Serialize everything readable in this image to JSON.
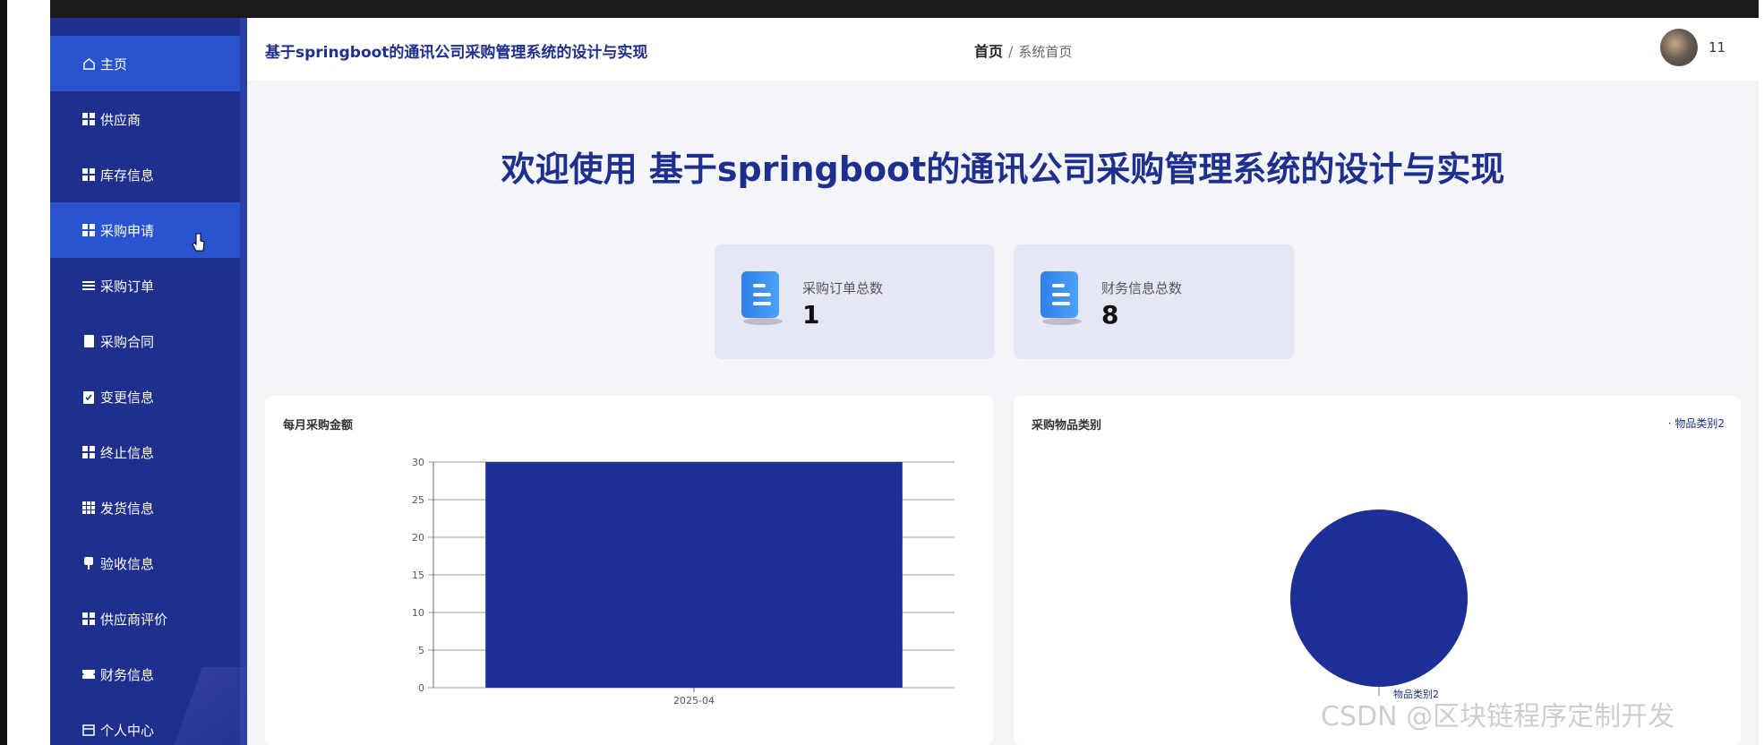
{
  "app": {
    "title": "基于springboot的通讯公司采购管理系统的设计与实现"
  },
  "sidebar": {
    "items": [
      {
        "label": "主页",
        "icon": "home-icon",
        "active": true
      },
      {
        "label": "供应商",
        "icon": "grid-icon",
        "active": false
      },
      {
        "label": "库存信息",
        "icon": "grid-icon",
        "active": false
      },
      {
        "label": "采购申请",
        "icon": "grid-icon",
        "active": true
      },
      {
        "label": "采购订单",
        "icon": "list-icon",
        "active": false
      },
      {
        "label": "采购合同",
        "icon": "clipboard-icon",
        "active": false
      },
      {
        "label": "变更信息",
        "icon": "clipboard-check-icon",
        "active": false
      },
      {
        "label": "终止信息",
        "icon": "grid-icon",
        "active": false
      },
      {
        "label": "发货信息",
        "icon": "table-icon",
        "active": false
      },
      {
        "label": "验收信息",
        "icon": "stamp-icon",
        "active": false
      },
      {
        "label": "供应商评价",
        "icon": "grid-icon",
        "active": false
      },
      {
        "label": "财务信息",
        "icon": "ticket-icon",
        "active": false
      },
      {
        "label": "个人中心",
        "icon": "window-icon",
        "active": false
      }
    ]
  },
  "header": {
    "breadcrumb": {
      "home": "首页",
      "separator": "/",
      "current": "系统首页"
    },
    "user": {
      "name": "11"
    }
  },
  "welcome": {
    "text": "欢迎使用 基于springboot的通讯公司采购管理系统的设计与实现"
  },
  "stats": [
    {
      "label": "采购订单总数",
      "value": "1",
      "icon": "document-icon"
    },
    {
      "label": "财务信息总数",
      "value": "8",
      "icon": "document-icon"
    }
  ],
  "chart_data": [
    {
      "type": "bar",
      "title": "每月采购金额",
      "categories": [
        "2025-04"
      ],
      "values": [
        30
      ],
      "ylim": [
        0,
        30
      ],
      "yticks": [
        0,
        5,
        10,
        15,
        20,
        25,
        30
      ],
      "grid": true,
      "color": "#1e2f95"
    },
    {
      "type": "pie",
      "title": "采购物品类别",
      "labels": [
        "物品类别2"
      ],
      "values": [
        1
      ],
      "legend": "top-right",
      "color": "#1e2f95"
    }
  ],
  "watermark": "CSDN @区块链程序定制开发",
  "colors": {
    "sidebar": "#1e2f8e",
    "active": "#2a53cf",
    "accent": "#49d3f0",
    "bar": "#1e2f95"
  }
}
